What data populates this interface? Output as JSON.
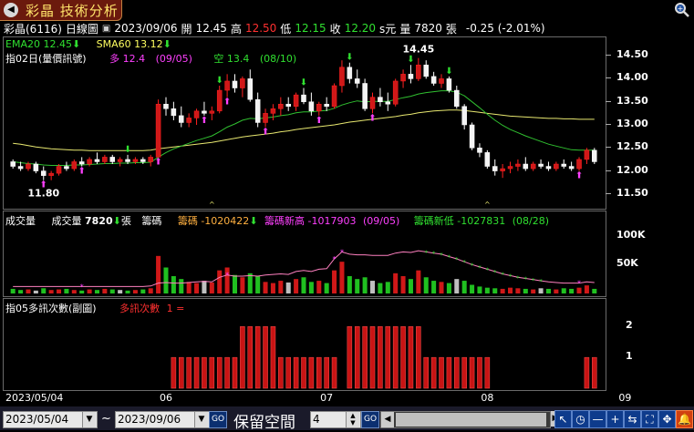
{
  "window": {
    "title": "彩晶 技術分析",
    "close_icon": "close-icon",
    "zoom_icon": "magnifier-icon"
  },
  "info": {
    "stock": "彩晶(6116)",
    "period": "日線圖",
    "date": "2023/09/06",
    "open_label": "開",
    "open": "12.45",
    "high_label": "高",
    "high": "12.50",
    "low_label": "低",
    "low": "12.15",
    "close_label": "收",
    "close": "12.20",
    "unit": "s元",
    "vol_label": "量",
    "vol": "7820",
    "vol_unit": "張",
    "change": "-0.25 (-2.01%)"
  },
  "price_panel": {
    "ema_label": "EMA20 12.45",
    "sma_label": "SMA60 13.12",
    "indicator_name": "指02日(量價訊號)",
    "long_label": "多 12.4",
    "long_date": "(09/05)",
    "short_label": "空 13.4",
    "short_date": "(08/10)",
    "high_mark": "14.45",
    "low_mark": "11.80",
    "y_ticks": [
      "14.50",
      "14.00",
      "13.50",
      "13.00",
      "12.50",
      "12.00",
      "11.50"
    ]
  },
  "volume_panel": {
    "title": "成交量",
    "vol_label": "成交量",
    "vol_value": "7820",
    "vol_unit": "張",
    "chip_label": "籌碼",
    "chip_value": "籌碼 -1020422",
    "chip_high": "籌碼新高 -1017903",
    "chip_high_date": "(09/05)",
    "chip_low": "籌碼新低 -1027831",
    "chip_low_date": "(08/28)",
    "y_ticks": [
      "100K",
      "50K"
    ]
  },
  "indicator_panel": {
    "title": "指05多訊次數(副圖)",
    "series_label": "多訊次數",
    "series_value": "1 =",
    "y_ticks": [
      "2",
      "1"
    ]
  },
  "x_axis": {
    "labels": [
      "2023/05/04",
      "06",
      "07",
      "08",
      "09"
    ]
  },
  "bottom": {
    "from_date": "2023/05/04",
    "tilde": "~",
    "to_date": "2023/09/06",
    "go_label": "GO",
    "keep_label": "保留空間",
    "keep_value": "4",
    "go2_label": "GO"
  },
  "chart_data": {
    "type": "candlestick",
    "ylim": [
      11.3,
      14.7
    ],
    "candles": [
      [
        12.2,
        12.25,
        12.05,
        12.1
      ],
      [
        12.1,
        12.2,
        12.0,
        12.05
      ],
      [
        12.05,
        12.2,
        12.0,
        12.15
      ],
      [
        12.15,
        12.2,
        11.95,
        12.0
      ],
      [
        12.0,
        12.1,
        11.8,
        11.9
      ],
      [
        11.9,
        12.0,
        11.8,
        11.95
      ],
      [
        11.95,
        12.15,
        11.9,
        12.1
      ],
      [
        12.1,
        12.2,
        12.0,
        12.05
      ],
      [
        12.05,
        12.25,
        12.0,
        12.2
      ],
      [
        12.2,
        12.3,
        12.1,
        12.15
      ],
      [
        12.15,
        12.3,
        12.1,
        12.25
      ],
      [
        12.25,
        12.4,
        12.15,
        12.2
      ],
      [
        12.2,
        12.35,
        12.15,
        12.3
      ],
      [
        12.3,
        12.35,
        12.15,
        12.2
      ],
      [
        12.2,
        12.3,
        12.1,
        12.25
      ],
      [
        12.25,
        12.35,
        12.15,
        12.2
      ],
      [
        12.2,
        12.3,
        12.15,
        12.25
      ],
      [
        12.25,
        12.3,
        12.15,
        12.2
      ],
      [
        12.2,
        12.35,
        12.1,
        12.3
      ],
      [
        12.3,
        13.55,
        12.3,
        13.45
      ],
      [
        13.45,
        13.6,
        13.2,
        13.35
      ],
      [
        13.35,
        13.5,
        13.1,
        13.2
      ],
      [
        13.2,
        13.4,
        12.95,
        13.05
      ],
      [
        13.05,
        13.25,
        12.95,
        13.15
      ],
      [
        13.15,
        13.35,
        13.0,
        13.3
      ],
      [
        13.3,
        13.5,
        13.2,
        13.25
      ],
      [
        13.25,
        13.4,
        13.1,
        13.3
      ],
      [
        13.3,
        13.85,
        13.25,
        13.75
      ],
      [
        13.75,
        14.1,
        13.6,
        13.95
      ],
      [
        13.95,
        14.1,
        13.7,
        13.8
      ],
      [
        13.8,
        14.05,
        13.6,
        14.0
      ],
      [
        14.0,
        14.2,
        13.5,
        13.55
      ],
      [
        13.55,
        13.7,
        12.95,
        13.05
      ],
      [
        13.05,
        13.35,
        12.95,
        13.25
      ],
      [
        13.25,
        13.45,
        13.1,
        13.35
      ],
      [
        13.35,
        13.6,
        13.2,
        13.45
      ],
      [
        13.45,
        13.6,
        13.3,
        13.4
      ],
      [
        13.4,
        13.7,
        13.3,
        13.65
      ],
      [
        13.65,
        13.8,
        13.45,
        13.5
      ],
      [
        13.5,
        13.7,
        13.2,
        13.3
      ],
      [
        13.3,
        13.5,
        13.2,
        13.45
      ],
      [
        13.45,
        13.6,
        13.3,
        13.4
      ],
      [
        13.4,
        13.9,
        13.35,
        13.85
      ],
      [
        13.85,
        14.4,
        13.7,
        14.25
      ],
      [
        14.25,
        14.35,
        13.9,
        14.0
      ],
      [
        14.0,
        14.2,
        13.8,
        13.9
      ],
      [
        13.9,
        14.0,
        13.3,
        13.35
      ],
      [
        13.35,
        13.7,
        13.25,
        13.6
      ],
      [
        13.6,
        13.8,
        13.4,
        13.5
      ],
      [
        13.5,
        13.7,
        13.3,
        13.45
      ],
      [
        13.45,
        14.0,
        13.4,
        13.95
      ],
      [
        13.95,
        14.2,
        13.8,
        14.1
      ],
      [
        14.1,
        14.3,
        13.9,
        14.0
      ],
      [
        14.0,
        14.45,
        13.95,
        14.3
      ],
      [
        14.3,
        14.4,
        14.0,
        14.05
      ],
      [
        14.05,
        14.15,
        13.85,
        13.9
      ],
      [
        13.9,
        14.1,
        13.8,
        14.0
      ],
      [
        14.0,
        14.05,
        13.7,
        13.75
      ],
      [
        13.75,
        13.85,
        13.35,
        13.4
      ],
      [
        13.4,
        13.45,
        12.9,
        13.0
      ],
      [
        13.0,
        13.05,
        12.45,
        12.5
      ],
      [
        12.5,
        12.6,
        12.3,
        12.4
      ],
      [
        12.4,
        12.45,
        12.05,
        12.1
      ],
      [
        12.1,
        12.25,
        11.9,
        12.0
      ],
      [
        12.0,
        12.15,
        11.85,
        12.05
      ],
      [
        12.05,
        12.2,
        11.95,
        12.1
      ],
      [
        12.1,
        12.25,
        12.0,
        12.15
      ],
      [
        12.15,
        12.3,
        12.0,
        12.05
      ],
      [
        12.05,
        12.2,
        12.0,
        12.15
      ],
      [
        12.15,
        12.25,
        12.05,
        12.1
      ],
      [
        12.1,
        12.2,
        12.0,
        12.05
      ],
      [
        12.05,
        12.2,
        12.0,
        12.15
      ],
      [
        12.15,
        12.25,
        12.05,
        12.1
      ],
      [
        12.1,
        12.2,
        12.0,
        12.05
      ],
      [
        12.05,
        12.3,
        12.0,
        12.25
      ],
      [
        12.25,
        12.5,
        12.15,
        12.45
      ],
      [
        12.45,
        12.5,
        12.15,
        12.2
      ]
    ],
    "ema20": [
      12.2,
      12.18,
      12.16,
      12.15,
      12.13,
      12.12,
      12.12,
      12.12,
      12.13,
      12.13,
      12.14,
      12.15,
      12.16,
      12.16,
      12.17,
      12.17,
      12.18,
      12.18,
      12.19,
      12.3,
      12.4,
      12.48,
      12.54,
      12.6,
      12.66,
      12.71,
      12.76,
      12.85,
      12.95,
      13.02,
      13.1,
      13.14,
      13.13,
      13.15,
      13.17,
      13.2,
      13.22,
      13.26,
      13.28,
      13.28,
      13.3,
      13.31,
      13.36,
      13.43,
      13.48,
      13.52,
      13.5,
      13.51,
      13.51,
      13.51,
      13.55,
      13.59,
      13.62,
      13.67,
      13.7,
      13.72,
      13.74,
      13.74,
      13.71,
      13.63,
      13.5,
      13.37,
      13.23,
      13.1,
      12.99,
      12.9,
      12.83,
      12.76,
      12.7,
      12.64,
      12.58,
      12.54,
      12.5,
      12.46,
      12.45,
      12.45,
      12.45
    ],
    "sma60": [
      12.6,
      12.58,
      12.55,
      12.52,
      12.5,
      12.48,
      12.47,
      12.46,
      12.45,
      12.45,
      12.44,
      12.44,
      12.44,
      12.44,
      12.44,
      12.44,
      12.44,
      12.44,
      12.45,
      12.48,
      12.5,
      12.52,
      12.54,
      12.56,
      12.58,
      12.6,
      12.62,
      12.65,
      12.68,
      12.71,
      12.74,
      12.76,
      12.78,
      12.8,
      12.82,
      12.85,
      12.87,
      12.9,
      12.92,
      12.94,
      12.96,
      12.98,
      13.0,
      13.03,
      13.06,
      13.08,
      13.1,
      13.12,
      13.14,
      13.16,
      13.18,
      13.21,
      13.23,
      13.26,
      13.28,
      13.3,
      13.31,
      13.32,
      13.32,
      13.31,
      13.29,
      13.27,
      13.25,
      13.23,
      13.21,
      13.19,
      13.18,
      13.17,
      13.16,
      13.15,
      13.14,
      13.14,
      13.13,
      13.13,
      13.12,
      13.12,
      13.12
    ],
    "volumes": [
      8,
      6,
      7,
      5,
      9,
      6,
      7,
      8,
      6,
      5,
      7,
      6,
      8,
      7,
      6,
      5,
      6,
      7,
      9,
      65,
      45,
      30,
      25,
      20,
      18,
      22,
      19,
      40,
      45,
      32,
      28,
      35,
      30,
      20,
      18,
      22,
      19,
      25,
      28,
      20,
      22,
      18,
      40,
      55,
      30,
      25,
      28,
      22,
      18,
      20,
      35,
      30,
      25,
      40,
      28,
      22,
      20,
      18,
      25,
      22,
      15,
      12,
      10,
      9,
      8,
      10,
      9,
      8,
      7,
      9,
      8,
      7,
      9,
      8,
      10,
      14,
      8
    ],
    "chip_line": [
      12,
      12,
      12,
      12,
      12,
      12,
      12,
      12,
      12,
      12,
      12,
      12,
      12,
      12,
      12,
      12,
      12,
      12,
      13,
      18,
      19,
      18,
      18,
      19,
      20,
      21,
      20,
      28,
      32,
      30,
      30,
      31,
      30,
      32,
      33,
      34,
      33,
      38,
      40,
      38,
      42,
      43,
      60,
      72,
      68,
      67,
      67,
      66,
      66,
      66,
      70,
      72,
      71,
      74,
      72,
      70,
      68,
      64,
      60,
      55,
      50,
      46,
      42,
      38,
      34,
      31,
      28,
      26,
      24,
      22,
      20,
      19,
      18,
      18,
      18,
      20,
      19
    ],
    "signals": [
      0,
      0,
      0,
      0,
      0,
      0,
      0,
      0,
      0,
      0,
      0,
      0,
      0,
      0,
      0,
      0,
      0,
      0,
      0,
      0,
      0,
      1,
      1,
      1,
      1,
      1,
      1,
      1,
      1,
      1,
      2,
      2,
      2,
      2,
      2,
      1,
      1,
      1,
      1,
      1,
      1,
      1,
      1,
      0,
      2,
      2,
      2,
      2,
      2,
      2,
      2,
      2,
      2,
      2,
      1,
      1,
      1,
      1,
      1,
      1,
      1,
      1,
      1,
      0,
      0,
      0,
      0,
      0,
      0,
      0,
      0,
      0,
      0,
      0,
      0,
      1,
      1
    ]
  }
}
